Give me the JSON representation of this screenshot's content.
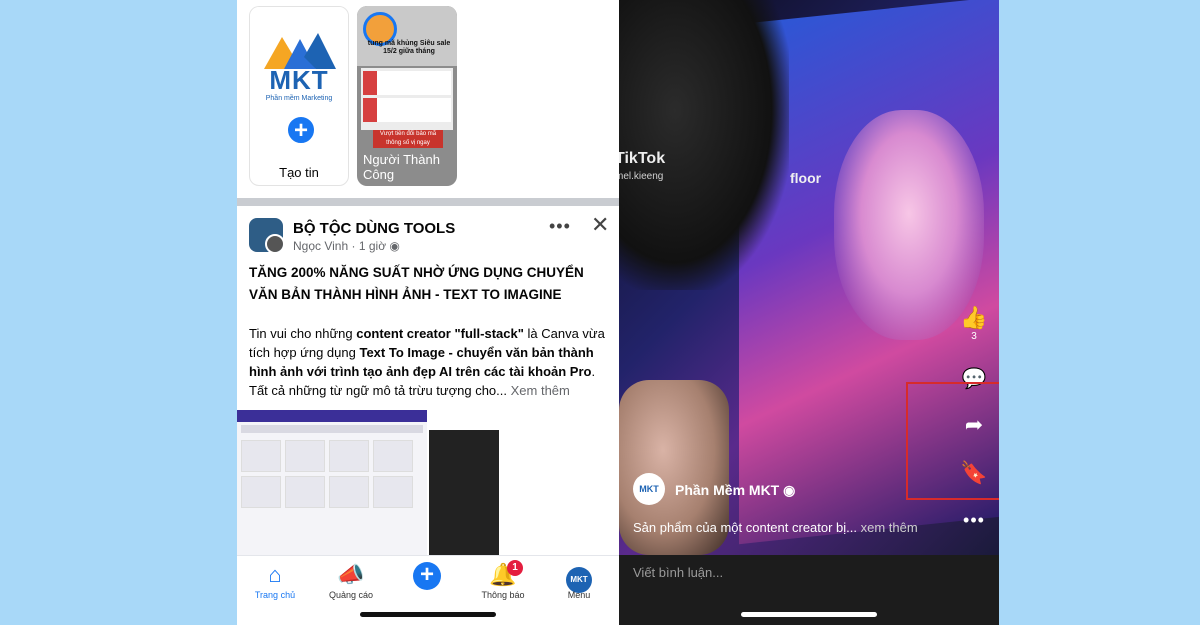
{
  "stories": {
    "create": {
      "brand": "MKT",
      "brand_sub": "Phần mềm Marketing",
      "label": "Tạo tin"
    },
    "card": {
      "promo_text": "tung mã khủng Siêu sale 15/2 giữa tháng",
      "note_text": "Vượt tiền đổi bảo mã thông số vị ngay",
      "name": "Người Thành Công"
    }
  },
  "post": {
    "group_name": "BỘ TỘC DÙNG TOOLS",
    "author": "Ngọc Vinh",
    "time": "1 giờ",
    "more_icon": "•••",
    "close_icon": "✕",
    "title": "TĂNG 200% NĂNG SUẤT NHỜ ỨNG DỤNG CHUYỂN VĂN BẢN THÀNH HÌNH ẢNH - TEXT TO IMAGINE",
    "body_parts": {
      "p1": "Tin vui cho những ",
      "b1": "content creator \"full-stack\"",
      "p2": " là Canva vừa tích hợp ứng dụng ",
      "b2": "Text To Image - chuyển văn bản thành hình ảnh với trình tạo ảnh đẹp AI trên các tài khoản Pro",
      "p3": ". Tất cả những từ ngữ mô tả trừu tượng cho...",
      "more": " Xem thêm"
    }
  },
  "bottom_nav": {
    "home": "Trang chủ",
    "ads": "Quảng cáo",
    "notifications": "Thông báo",
    "notifications_badge": "1",
    "menu": "Menu"
  },
  "reel": {
    "watermark_brand": "TikTok",
    "watermark_handle": "mel.kieeng",
    "overlay_text": "floor",
    "like_count": "3",
    "author_avatar_text": "MKT",
    "author_name": "Phần Mềm MKT",
    "caption": "Sản phẩm của một content creator bị...",
    "caption_more": " xem thêm",
    "comment_placeholder": "Viết bình luận..."
  },
  "colors": {
    "background": "#a8d8f8",
    "facebook_blue": "#1877f2",
    "highlight_red": "#d72b2b",
    "badge_red": "#e41e3f"
  },
  "icons": {
    "nav": [
      "home-icon",
      "megaphone-icon",
      "plus-icon",
      "bell-icon",
      "avatar-menu-icon"
    ],
    "reel_actions": [
      "like-icon",
      "comment-icon",
      "share-icon",
      "bookmark-icon",
      "more-icon"
    ]
  }
}
